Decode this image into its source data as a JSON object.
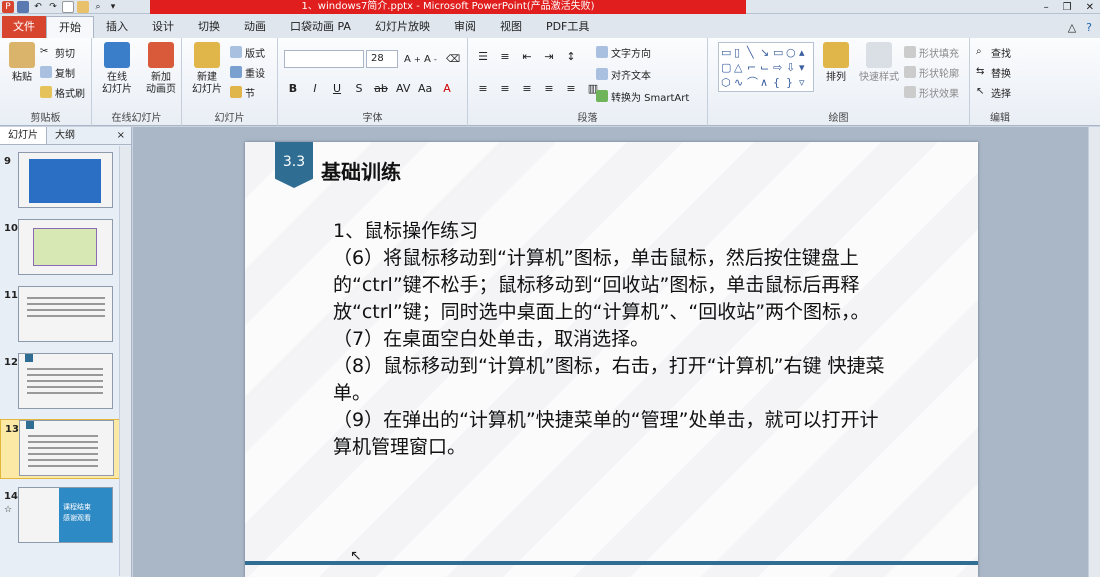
{
  "titlebar": {
    "title": "1、windows7简介.pptx - Microsoft PowerPoint(产品激活失败)",
    "min": "–",
    "restore": "❐",
    "close": "✕"
  },
  "tabs": {
    "file": "文件",
    "home": "开始",
    "insert": "插入",
    "design": "设计",
    "transitions": "切换",
    "animations": "动画",
    "pocket": "口袋动画 PA",
    "slideshow": "幻灯片放映",
    "review": "审阅",
    "view": "视图",
    "pdf": "PDF工具"
  },
  "ribbon": {
    "clipboard": {
      "paste": "粘贴",
      "cut": "剪切",
      "copy": "复制",
      "painter": "格式刷",
      "label": "剪贴板"
    },
    "online": {
      "online_btn": "在线\n幻灯片",
      "new_anim": "新加\n动画页",
      "label": "在线幻灯片"
    },
    "slides": {
      "new_slide": "新建\n幻灯片",
      "layout": "版式",
      "reset": "重设",
      "section": "节",
      "label": "幻灯片"
    },
    "font": {
      "size": "28",
      "label": "字体"
    },
    "paragraph": {
      "text_dir": "文字方向",
      "align_text": "对齐文本",
      "smartart": "转换为 SmartArt",
      "label": "段落"
    },
    "drawing": {
      "arrange": "排列",
      "quick_styles": "快速样式",
      "fill": "形状填充",
      "outline": "形状轮廓",
      "effects": "形状效果",
      "label": "绘图"
    },
    "editing": {
      "find": "查找",
      "replace": "替换",
      "select": "选择",
      "label": "编辑"
    }
  },
  "leftpane": {
    "tab_slides": "幻灯片",
    "tab_outline": "大纲",
    "close": "×",
    "thumbs": [
      {
        "num": "9"
      },
      {
        "num": "10"
      },
      {
        "num": "11"
      },
      {
        "num": "12"
      },
      {
        "num": "13"
      },
      {
        "num": "14"
      }
    ],
    "last_thumb_text": "课程结束\n感谢观看",
    "last_thumb_note": "☆"
  },
  "slide": {
    "badge": "3.3",
    "title": "基础训练",
    "lines": [
      "1、鼠标操作练习",
      "（6）将鼠标移动到“计算机”图标，单击鼠标，然后按住键盘上的“ctrl”键不松手；鼠标移动到“回收站”图标，单击鼠标后再释放“ctrl”键；同时选中桌面上的“计算机”、“回收站”两个图标，。",
      "（7）在桌面空白处单击，取消选择。",
      "（8）鼠标移动到“计算机”图标，右击，打开“计算机”右键 快捷菜单。",
      "（9）在弹出的“计算机”快捷菜单的“管理”处单击，就可以打开计算机管理窗口。"
    ]
  }
}
